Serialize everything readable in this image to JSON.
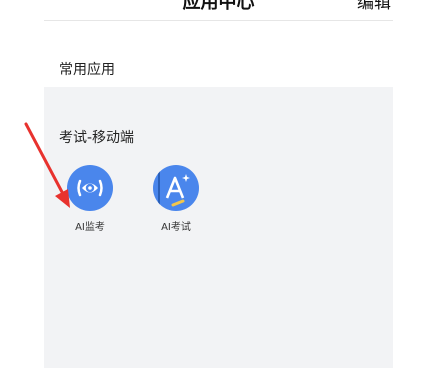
{
  "header": {
    "title": "应用中心",
    "edit_label": "编辑"
  },
  "sections": {
    "common": {
      "title": "常用应用"
    },
    "exam": {
      "title": "考试-移动端",
      "apps": [
        {
          "label": "AI监考",
          "icon": "eye-icon"
        },
        {
          "label": "AI考试",
          "icon": "letter-a-sparkle-icon"
        }
      ]
    }
  },
  "colors": {
    "icon_bg": "#4a86ec",
    "arrow": "#e8322e",
    "page_bg": "#f2f3f5"
  }
}
